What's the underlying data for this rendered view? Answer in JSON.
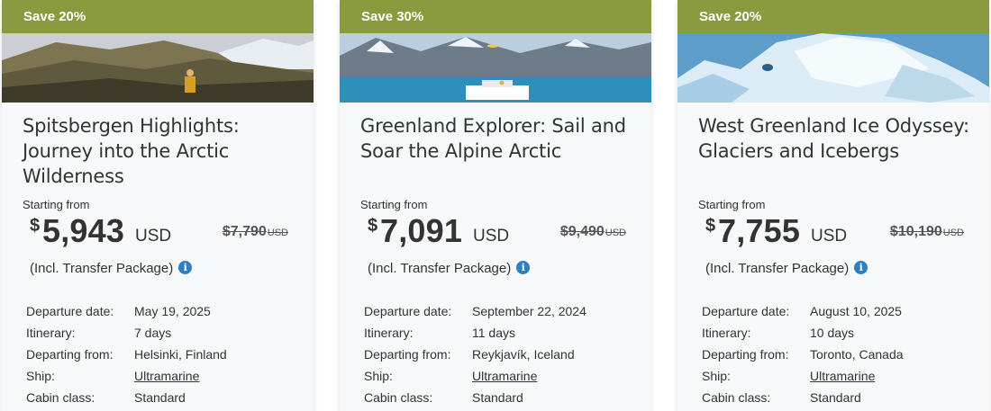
{
  "cards": [
    {
      "badge": "Save 20%",
      "title": "Spitsbergen Highlights: Journey into the Arctic Wilderness",
      "starting_label": "Starting from",
      "currency_symbol": "$",
      "price": "5,943",
      "price_unit": "USD",
      "old_price": "$7,790",
      "old_unit": "USD",
      "incl": "(Incl. Transfer Package)",
      "details": [
        {
          "label": "Departure date:",
          "value": "May 19, 2025"
        },
        {
          "label": "Itinerary:",
          "value": "7 days"
        },
        {
          "label": "Departing from:",
          "value": "Helsinki, Finland"
        },
        {
          "label": "Ship:",
          "value": "Ultramarine"
        },
        {
          "label": "Cabin class:",
          "value": "Standard"
        }
      ]
    },
    {
      "badge": "Save 30%",
      "title": "Greenland Explorer: Sail and Soar the Alpine Arctic",
      "starting_label": "Starting from",
      "currency_symbol": "$",
      "price": "7,091",
      "price_unit": "USD",
      "old_price": "$9,490",
      "old_unit": "USD",
      "incl": "(Incl. Transfer Package)",
      "details": [
        {
          "label": "Departure date:",
          "value": "September 22, 2024"
        },
        {
          "label": "Itinerary:",
          "value": "11 days"
        },
        {
          "label": "Departing from:",
          "value": "Reykjavík, Iceland"
        },
        {
          "label": "Ship:",
          "value": "Ultramarine"
        },
        {
          "label": "Cabin class:",
          "value": "Standard"
        }
      ]
    },
    {
      "badge": "Save 20%",
      "title": "West Greenland Ice Odyssey: Glaciers and Icebergs",
      "starting_label": "Starting from",
      "currency_symbol": "$",
      "price": "7,755",
      "price_unit": "USD",
      "old_price": "$10,190",
      "old_unit": "USD",
      "incl": "(Incl. Transfer Package)",
      "details": [
        {
          "label": "Departure date:",
          "value": "August 10, 2025"
        },
        {
          "label": "Itinerary:",
          "value": "10 days"
        },
        {
          "label": "Departing from:",
          "value": "Toronto, Canada"
        },
        {
          "label": "Ship:",
          "value": "Ultramarine"
        },
        {
          "label": "Cabin class:",
          "value": "Standard"
        }
      ]
    }
  ],
  "icons": {
    "info": "info-icon"
  },
  "colors": {
    "badge_bg": "#899a3f",
    "info_icon": "#2f7ec0",
    "card_bg": "#f7f8fa"
  }
}
